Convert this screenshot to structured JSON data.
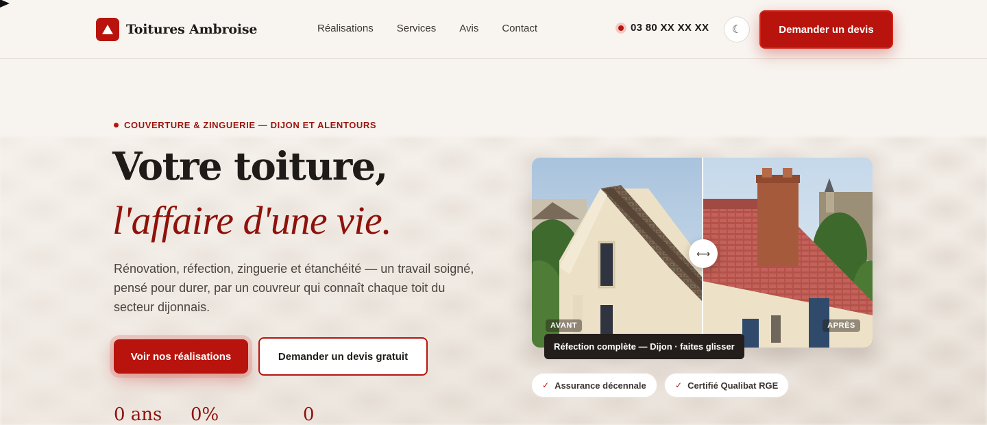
{
  "header": {
    "brand_name": "Toitures Ambroise",
    "nav": [
      "Réalisations",
      "Services",
      "Avis",
      "Contact"
    ],
    "phone": "03 80 XX XX XX",
    "theme_icon": "☾",
    "cta_label": "Demander un devis"
  },
  "hero": {
    "eyebrow": "COUVERTURE & ZINGUERIE — DIJON ET ALENTOURS",
    "title_line1": "Votre toiture,",
    "title_line2": "l'affaire d'une vie.",
    "lead": "Rénovation, réfection, zinguerie et étanchéité — un travail soigné, pensé pour durer, par un couvreur qui connaît chaque toit du secteur dijonnais.",
    "primary_button": "Voir nos réalisations",
    "secondary_button": "Demander un devis gratuit",
    "stats": [
      "0 ans",
      "0%",
      "0"
    ]
  },
  "comparison": {
    "before_label": "AVANT",
    "after_label": "APRÈS",
    "handle_icon": "⟷",
    "caption": "Réfection complète — Dijon · faites glisser"
  },
  "badges": [
    "Assurance décennale",
    "Certifié Qualibat RGE"
  ],
  "colors": {
    "accent": "#b8140d",
    "accent_dark": "#8e120b",
    "background": "#f7f3ee",
    "text": "#1f1b18"
  }
}
